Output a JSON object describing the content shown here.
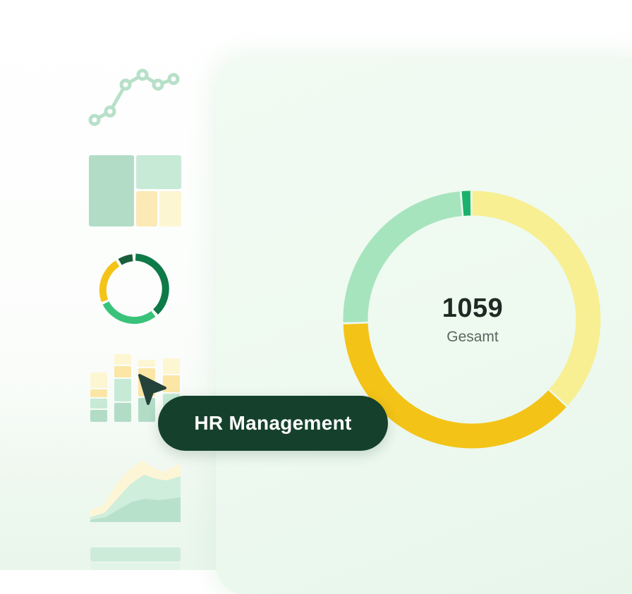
{
  "chart_data": {
    "type": "pie",
    "total": 1059,
    "total_label": "Gesamt",
    "series": [
      {
        "value": 14,
        "color": "#1ab26b"
      },
      {
        "value": 390,
        "color": "#f7ef92"
      },
      {
        "value": 400,
        "color": "#f3c317"
      },
      {
        "value": 255,
        "color": "#a6e4bd"
      }
    ]
  },
  "tooltip": {
    "label": "HR Management"
  },
  "colors": {
    "dark_green": "#15412c",
    "mint": "#a6e4bd",
    "gold": "#f3c317",
    "light_yellow": "#f7ef92",
    "green": "#1ab26b"
  },
  "sidebar_icons": [
    "line-chart-icon",
    "treemap-icon",
    "donut-chart-icon",
    "stacked-bar-icon",
    "area-chart-icon",
    "table-icon"
  ]
}
